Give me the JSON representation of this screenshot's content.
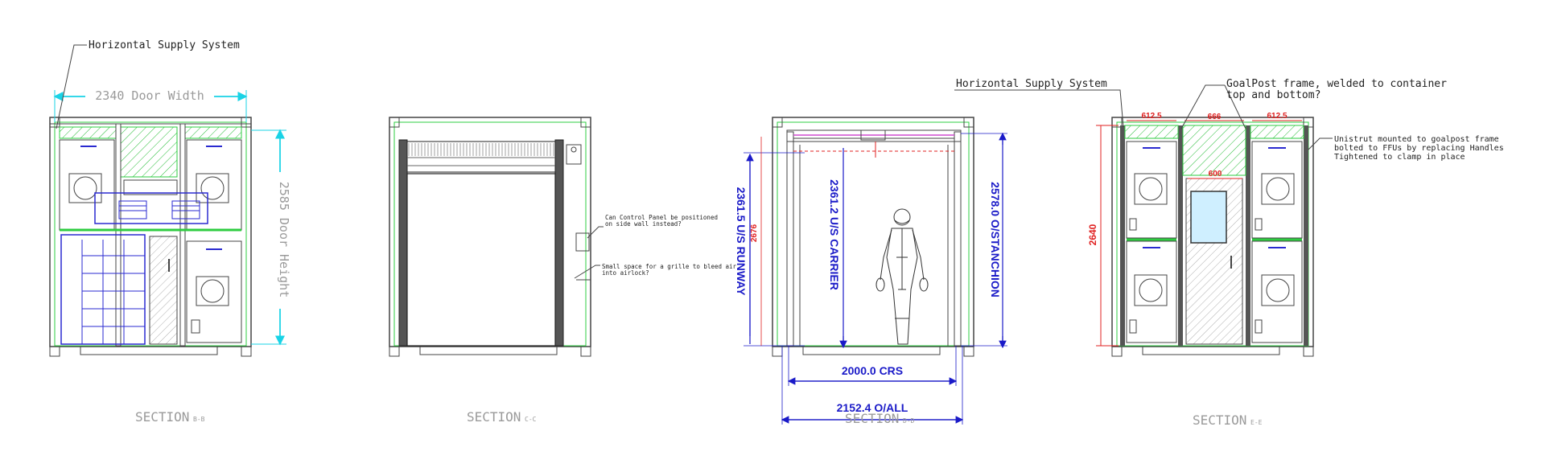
{
  "colors": {
    "frame": "#5a5a5a",
    "outline": "#222222",
    "green": "#2ecc40",
    "hatch": "#22bb33",
    "cyan": "#19d3e6",
    "blue": "#1a1ac8",
    "red": "#e02020",
    "panel_blue": "#2a2ad0",
    "label_grey": "#9a9a9a"
  },
  "section_b": {
    "supply_label": "Horizontal Supply System",
    "door_width": "2340 Door Width",
    "door_height": "2585 Door Height",
    "title": "SECTION",
    "title_suffix": "B-B"
  },
  "section_c": {
    "note_control_panel_line1": "Can Control Panel be positioned",
    "note_control_panel_line2": "on side wall instead?",
    "note_grille_line1": "Small space for a grille to bleed air",
    "note_grille_line2": "into airlock?",
    "title": "SECTION",
    "title_suffix": "C-C"
  },
  "section_d": {
    "runway": "2361.5 U/S RUNWAY",
    "runway_small": "2676",
    "carrier": "2361.2 U/S CARRIER",
    "stanchion": "2578.0 O/STANCHION",
    "crs": "2000.0 CRS",
    "overall": "2152.4 O/ALL",
    "title": "SECTION",
    "title_suffix": "D-D"
  },
  "section_e": {
    "supply_label": "Horizontal Supply System",
    "goalpost_line1": "GoalPost frame, welded to container",
    "goalpost_line2": "top and bottom?",
    "unistrut_line1": "Unistrut mounted to goalpost frame",
    "unistrut_line2": "bolted to FFUs by replacing Handles",
    "unistrut_line3": "Tightened to clamp in place",
    "dim_left": "612.5",
    "dim_mid": "666",
    "dim_right": "612.5",
    "dim_door": "600",
    "height": "2640",
    "title": "SECTION",
    "title_suffix": "E-E"
  }
}
